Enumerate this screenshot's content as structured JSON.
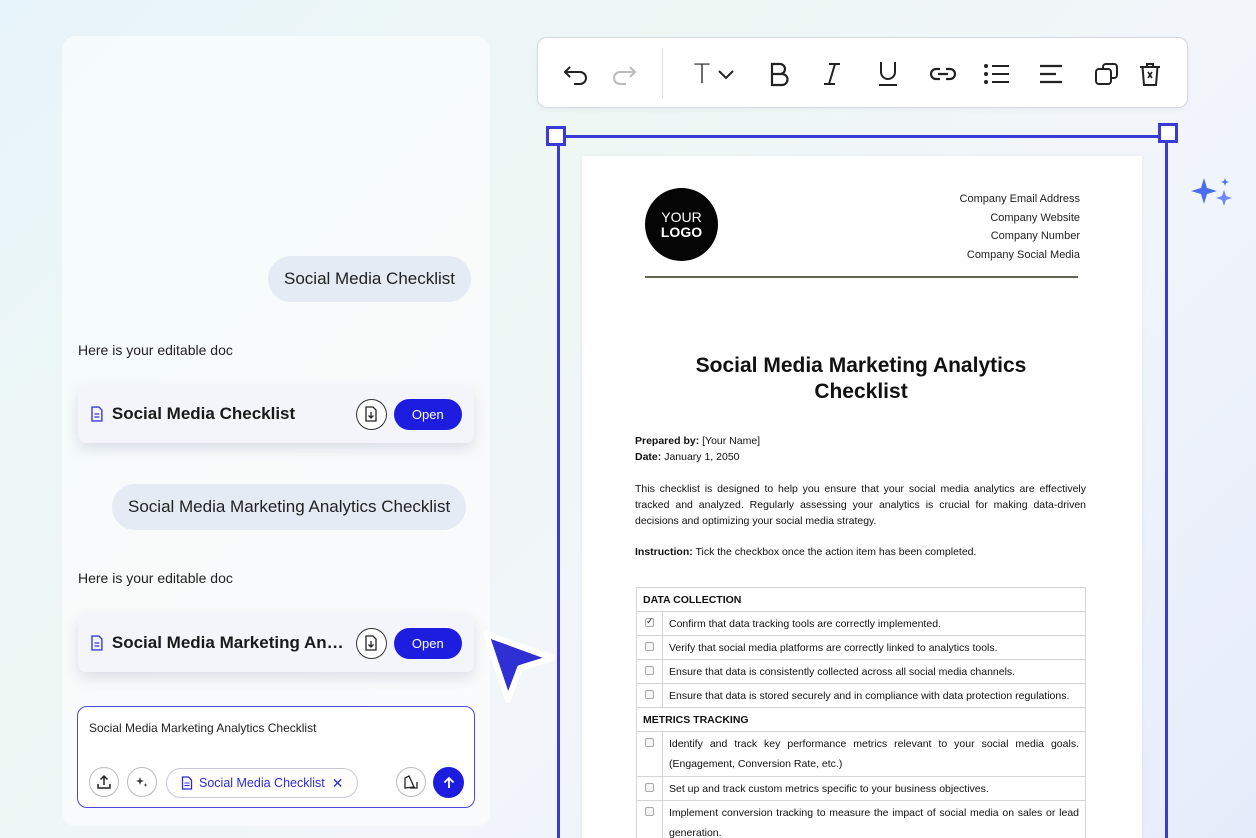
{
  "chat": {
    "messages": [
      {
        "role": "user",
        "text": "Social Media Checklist"
      },
      {
        "role": "assistant",
        "text": "Here is your editable doc",
        "doc_title": "Social Media Checklist",
        "open_label": "Open"
      },
      {
        "role": "user",
        "text": "Social Media Marketing Analytics Checklist"
      },
      {
        "role": "assistant",
        "text": "Here is your editable doc",
        "doc_title": "Social Media Marketing Analytics Checklist",
        "open_label": "Open"
      }
    ],
    "composer": {
      "value": "Social Media Marketing Analytics Checklist",
      "attachment_chip": "Social Media Checklist"
    }
  },
  "toolbar": {
    "icons": [
      "undo-icon",
      "redo-icon",
      "text-style-icon",
      "bold-icon",
      "italic-icon",
      "underline-icon",
      "link-icon",
      "bullet-list-icon",
      "align-icon",
      "duplicate-icon",
      "delete-icon"
    ],
    "text_style_label": "T"
  },
  "colors": {
    "accent": "#1d1de0",
    "selection": "#3a3ad6",
    "sparkle": "#4a6cf0"
  },
  "document": {
    "logo_line1": "YOUR",
    "logo_line2": "LOGO",
    "contact": [
      "Company Email Address",
      "Company Website",
      "Company Number",
      "Company Social Media"
    ],
    "title": "Social Media Marketing Analytics Checklist",
    "prepared_by_label": "Prepared by:",
    "prepared_by_value": "[Your Name]",
    "date_label": "Date:",
    "date_value": "January 1, 2050",
    "intro": "This checklist is designed to help you ensure that your social media analytics are effectively tracked and analyzed. Regularly assessing your analytics is crucial for making data-driven decisions and optimizing your social media strategy.",
    "instruction_label": "Instruction:",
    "instruction_text": "Tick the checkbox once the action item has been completed.",
    "sections": [
      {
        "heading": "DATA COLLECTION",
        "items": [
          {
            "text": "Confirm that data tracking tools are correctly implemented.",
            "checked": true
          },
          {
            "text": "Verify that social media platforms are correctly linked to analytics tools.",
            "checked": false
          },
          {
            "text": "Ensure that data is consistently collected across all social media channels.",
            "checked": false
          },
          {
            "text": "Ensure that data is stored securely and in compliance with data protection regulations.",
            "checked": false
          }
        ]
      },
      {
        "heading": "METRICS TRACKING",
        "items": [
          {
            "text": "Identify and track key performance metrics relevant to your social media goals. (Engagement, Conversion Rate, etc.)",
            "checked": false
          },
          {
            "text": "Set up and track custom metrics specific to your business objectives.",
            "checked": false
          },
          {
            "text": "Implement conversion tracking to measure the impact of social media on sales or lead generation.",
            "checked": false
          }
        ]
      }
    ]
  }
}
